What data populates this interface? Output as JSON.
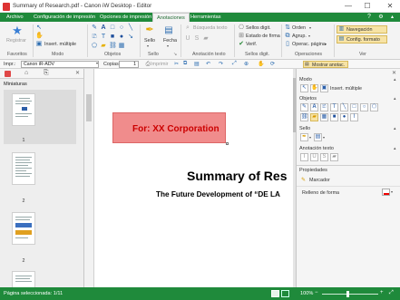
{
  "window": {
    "title": "Summary of Research.pdf - Canon iW Desktop - Editor",
    "minimize": "—",
    "maximize": "☐",
    "close": "✕"
  },
  "tabs": [
    "Archivo",
    "Configuración de impresión",
    "Opciones de impresión",
    "Anotaciones",
    "Herramientas"
  ],
  "ribbon": {
    "favoritos": {
      "label": "Favoritos",
      "registrar": "Registrar"
    },
    "modo": {
      "label": "Modo",
      "insert_multiple": "Insert. múltiple"
    },
    "objetos": {
      "label": "Objetos"
    },
    "sello": {
      "label": "Sello",
      "sello_btn": "Sello",
      "fecha_btn": "Fecha"
    },
    "anotacion_texto": {
      "label": "Anotación texto",
      "busqueda": "Búsqueda texto"
    },
    "sellos_digit": {
      "label": "Sellos digit.",
      "sellos": "Sellos digit.",
      "estado": "Estado de firma",
      "verif": "Verif."
    },
    "operaciones": {
      "label": "Operaciones",
      "orden": "Orden",
      "agrup": "Agrup.",
      "operac_pagina": "Operac. página"
    },
    "ver": {
      "label": "Ver",
      "navegacion": "Navegación",
      "config_formato": "Config. formato"
    }
  },
  "toolbar2": {
    "printer_label": "Impr.:",
    "printer_value": "Canon iR-ADV",
    "copies_label": "Copias:",
    "copies_value": "1",
    "print_btn": "Imprimir",
    "show_annotations": "Mostrar anotac."
  },
  "left_panel": {
    "title": "Miniaturas",
    "pages": [
      "1",
      "2",
      "2"
    ]
  },
  "document": {
    "stamp_text": "For: XX Corporation",
    "heading": "Summary of Res",
    "subheading": "The Future Development of “DE LA"
  },
  "right_panel": {
    "modo": {
      "title": "Modo",
      "insert_multiple": "Insert. múltiple"
    },
    "objetos": {
      "title": "Objetos"
    },
    "sello": {
      "title": "Sello"
    },
    "anotacion_texto": {
      "title": "Anotación texto"
    },
    "propiedades": {
      "title": "Propiedades",
      "marcador": "Marcador",
      "relleno": "Relleno de forma"
    }
  },
  "status": {
    "page_selected": "Página seleccionada: 1/11",
    "zoom": "100%"
  },
  "colors": {
    "brand_green": "#1f8a3b",
    "stamp_fill": "#f08c8c",
    "highlight": "#f7e3a5"
  }
}
